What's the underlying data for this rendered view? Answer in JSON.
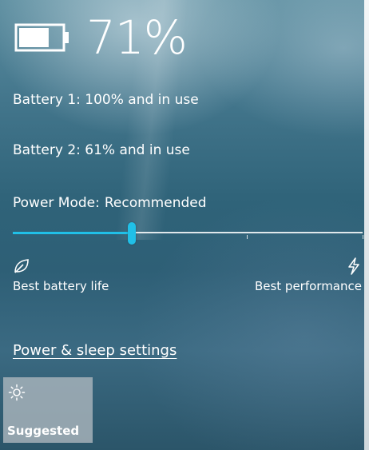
{
  "battery": {
    "percent": "71%",
    "charge_fraction": 0.71,
    "battery1": "Battery 1: 100% and in use",
    "battery2": "Battery 2: 61% and in use"
  },
  "power_mode": {
    "label": "Power Mode:",
    "value": "Recommended",
    "slider_fraction": 0.34,
    "left_label": "Best battery life",
    "right_label": "Best performance",
    "left_icon": "leaf-icon",
    "right_icon": "lightning-icon"
  },
  "settings_link": "Power & sleep settings",
  "tiles": [
    {
      "label": "Suggested",
      "icon": "brightness-sun-icon"
    }
  ],
  "colors": {
    "accent": "#20c0e8",
    "text": "#ffffff",
    "tile_bg": "#aab4bc"
  }
}
